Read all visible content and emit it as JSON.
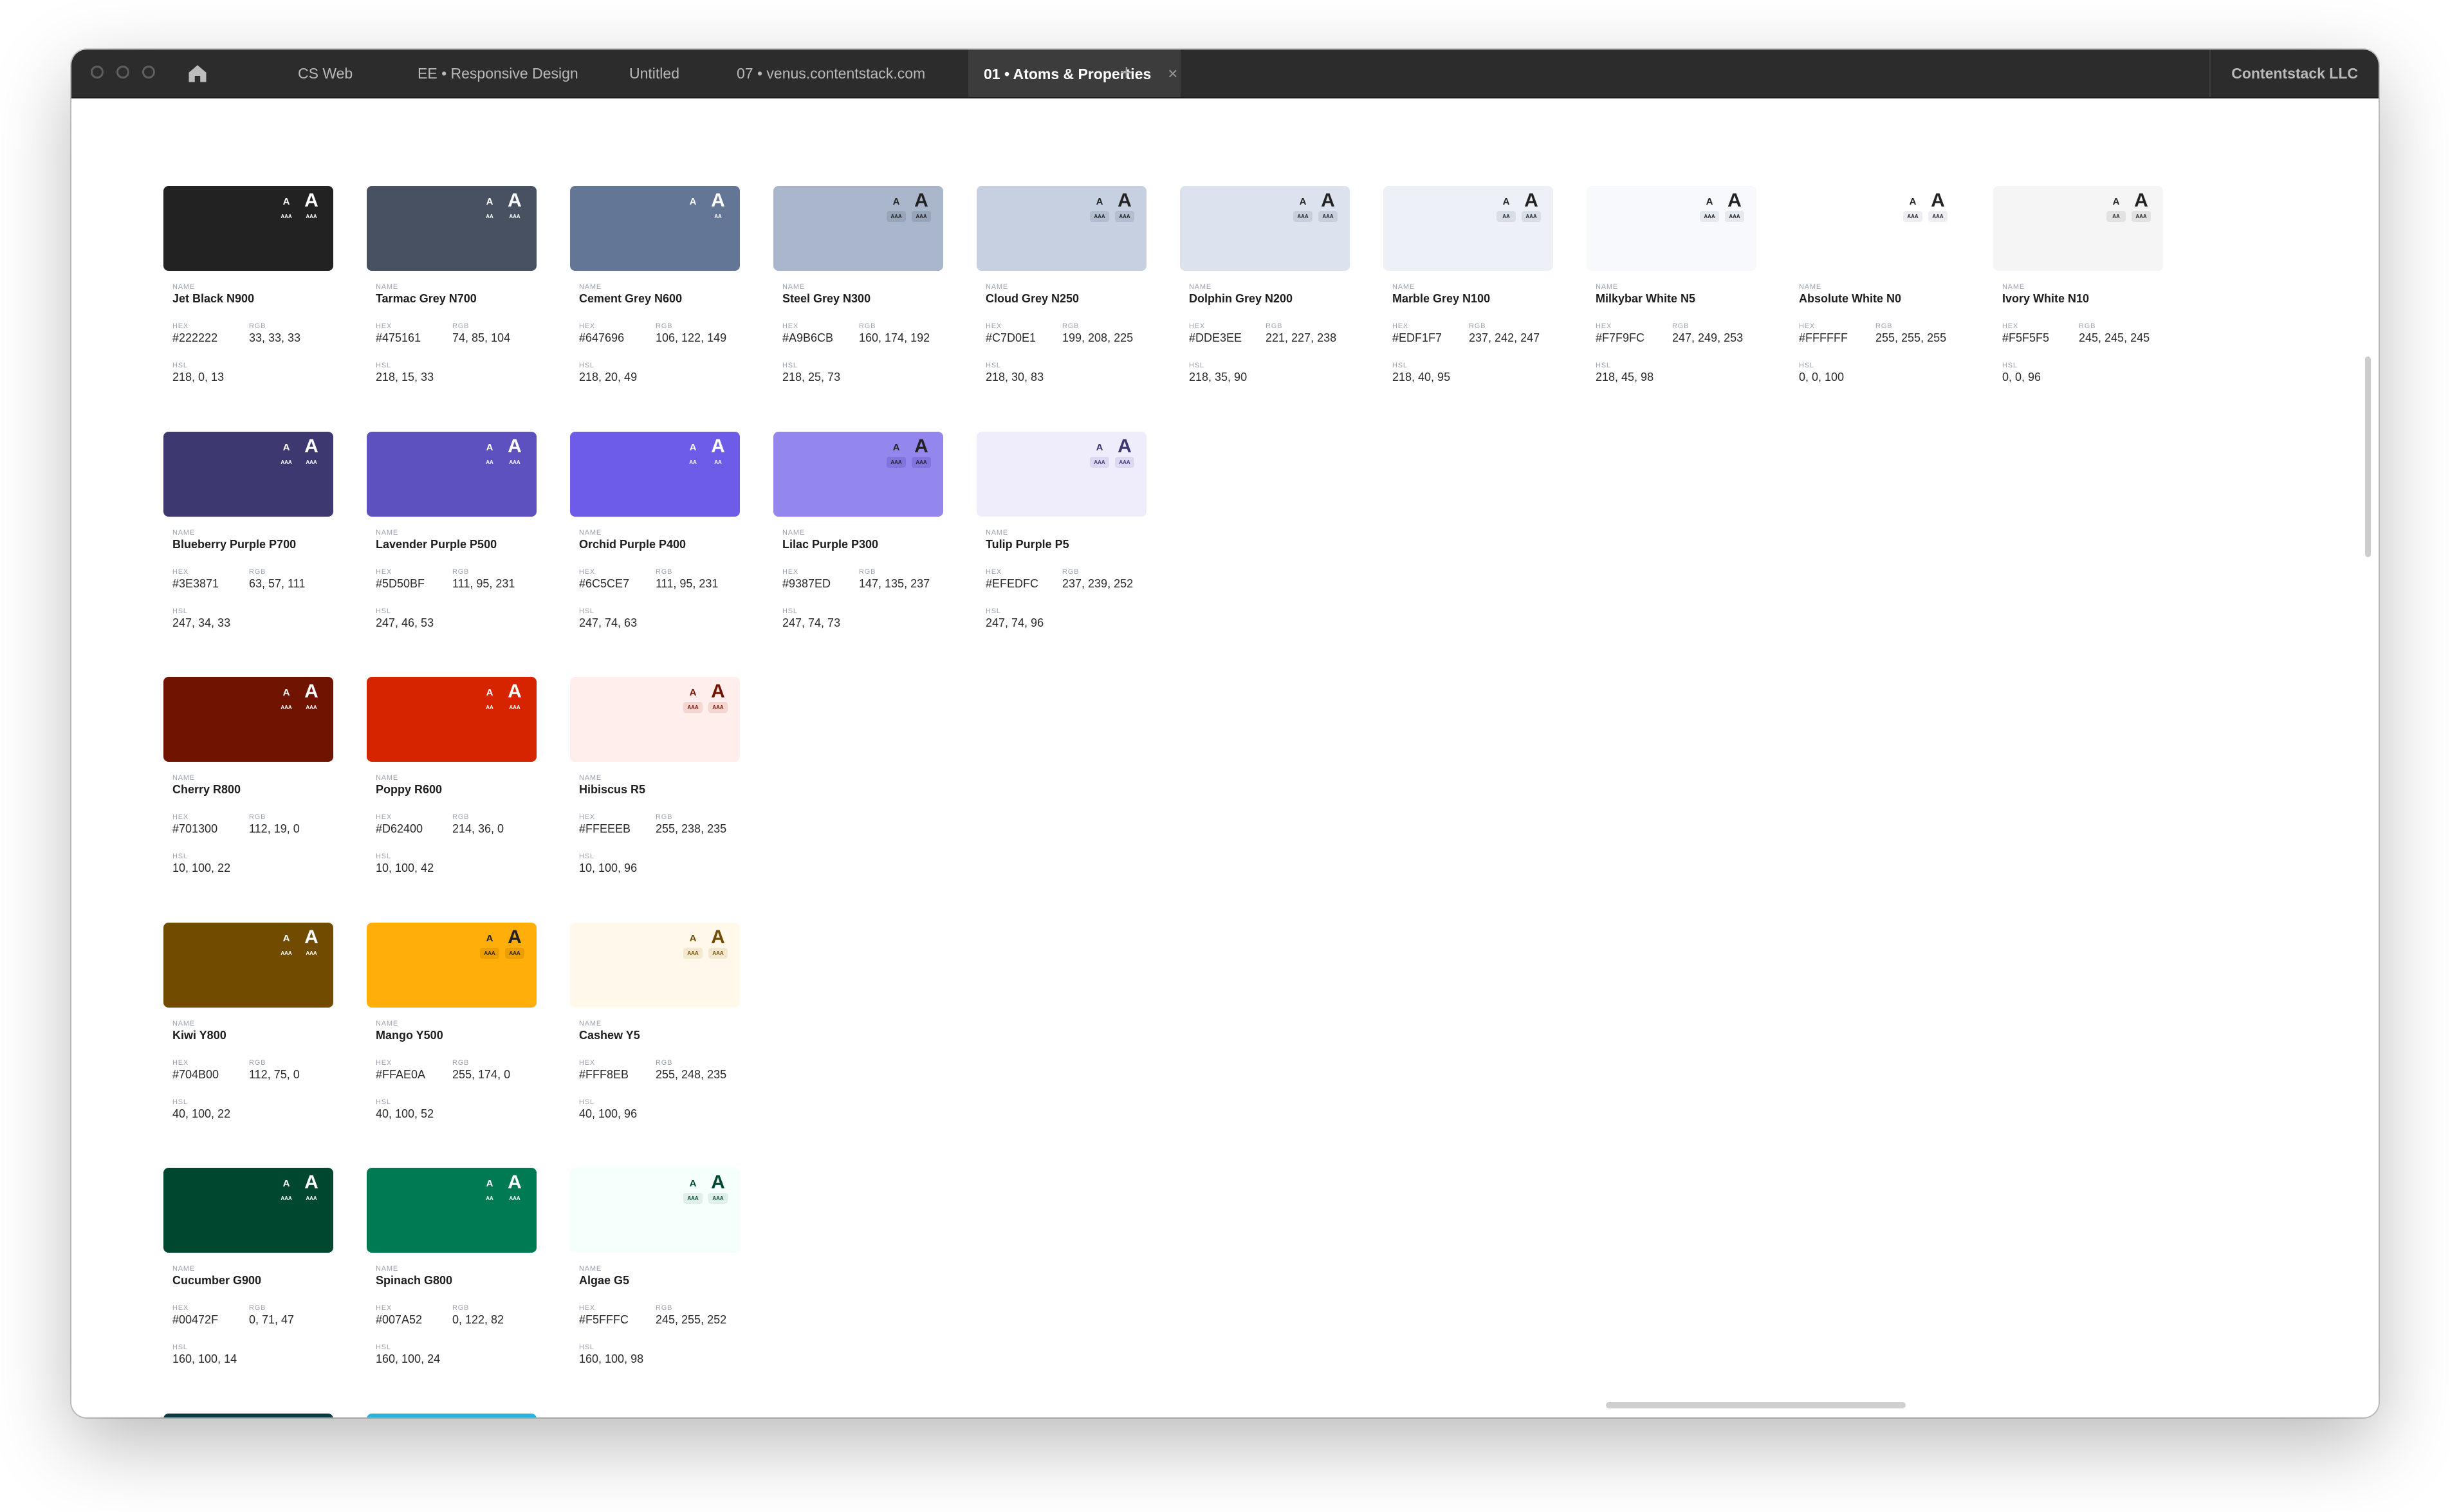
{
  "window": {
    "tabs": [
      {
        "label": "CS Web"
      },
      {
        "label": "EE • Responsive Design"
      },
      {
        "label": "Untitled"
      },
      {
        "label": "07 • venus.contentstack.com"
      },
      {
        "label": "01 • Atoms & Properties"
      }
    ],
    "active_tab_index": 4,
    "close_glyph": "×",
    "new_tab_glyph": "+",
    "org_name": "Contentstack LLC",
    "home_icon": "home-icon"
  },
  "labels": {
    "name": "NAME",
    "hex": "HEX",
    "rgb": "RGB",
    "hsl": "HSL"
  },
  "badges": {
    "glyph": "A",
    "aa": "AA",
    "aaa": "AAA"
  },
  "colors": [
    {
      "name": "Jet Black N900",
      "hex": "#222222",
      "rgb": "33, 33, 33",
      "hsl": "218, 0, 13",
      "fill": "#222222",
      "fg": "#ffffff",
      "small": "AAA",
      "big": "AAA",
      "pillbg": ""
    },
    {
      "name": "Tarmac Grey N700",
      "hex": "#475161",
      "rgb": "74, 85, 104",
      "hsl": "218, 15, 33",
      "fill": "#475161",
      "fg": "#ffffff",
      "small": "AA",
      "big": "AAA",
      "pillbg": ""
    },
    {
      "name": "Cement Grey N600",
      "hex": "#647696",
      "rgb": "106, 122, 149",
      "hsl": "218, 20, 49",
      "fill": "#647696",
      "fg": "#ffffff",
      "small": "",
      "big": "AA",
      "pillbg": ""
    },
    {
      "name": "Steel Grey N300",
      "hex": "#A9B6CB",
      "rgb": "160, 174, 192",
      "hsl": "218, 25, 73",
      "fill": "#A9B6CB",
      "fg": "#222222",
      "small": "AAA",
      "big": "AAA",
      "pillbg": "#97a4ba"
    },
    {
      "name": "Cloud Grey N250",
      "hex": "#C7D0E1",
      "rgb": "199, 208, 225",
      "hsl": "218, 30, 83",
      "fill": "#C7D0E1",
      "fg": "#222222",
      "small": "AAA",
      "big": "AAA",
      "pillbg": "#b3bdd0"
    },
    {
      "name": "Dolphin Grey N200",
      "hex": "#DDE3EE",
      "rgb": "221, 227, 238",
      "hsl": "218, 35, 90",
      "fill": "#DDE3EE",
      "fg": "#222222",
      "small": "AAA",
      "big": "AAA",
      "pillbg": "#c8d0de"
    },
    {
      "name": "Marble Grey N100",
      "hex": "#EDF1F7",
      "rgb": "237, 242, 247",
      "hsl": "218, 40, 95",
      "fill": "#EDF1F7",
      "fg": "#222222",
      "small": "AA",
      "big": "AAA",
      "pillbg": "#d8dee8"
    },
    {
      "name": "Milkybar White N5",
      "hex": "#F7F9FC",
      "rgb": "247, 249, 253",
      "hsl": "218, 45, 98",
      "fill": "#F7F9FC",
      "fg": "#222222",
      "small": "AAA",
      "big": "AAA",
      "pillbg": "#e4e8ef"
    },
    {
      "name": "Absolute White N0",
      "hex": "#FFFFFF",
      "rgb": "255, 255, 255",
      "hsl": "0, 0, 100",
      "fill": "#FFFFFF",
      "fg": "#222222",
      "small": "AAA",
      "big": "AAA",
      "pillbg": "#eceef2"
    },
    {
      "name": "Ivory White N10",
      "hex": "#F5F5F5",
      "rgb": "245, 245, 245",
      "hsl": "0, 0, 96",
      "fill": "#F5F5F5",
      "fg": "#222222",
      "small": "AA",
      "big": "AAA",
      "pillbg": "#e2e2e2"
    },
    {
      "name": "Blueberry Purple P700",
      "hex": "#3E3871",
      "rgb": "63, 57, 111",
      "hsl": "247, 34, 33",
      "fill": "#3E3871",
      "fg": "#ffffff",
      "small": "AAA",
      "big": "AAA",
      "pillbg": ""
    },
    {
      "name": "Lavender Purple P500",
      "hex": "#5D50BF",
      "rgb": "111, 95, 231",
      "hsl": "247, 46, 53",
      "fill": "#5D50BF",
      "fg": "#ffffff",
      "small": "AA",
      "big": "AAA",
      "pillbg": ""
    },
    {
      "name": "Orchid Purple P400",
      "hex": "#6C5CE7",
      "rgb": "111, 95, 231",
      "hsl": "247, 74, 63",
      "fill": "#6C5CE7",
      "fg": "#ffffff",
      "small": "AA",
      "big": "AA",
      "pillbg": ""
    },
    {
      "name": "Lilac Purple P300",
      "hex": "#9387ED",
      "rgb": "147, 135, 237",
      "hsl": "247, 74, 73",
      "fill": "#9387ED",
      "fg": "#222222",
      "small": "AAA",
      "big": "AAA",
      "pillbg": "#8175dd"
    },
    {
      "name": "Tulip Purple P5",
      "hex": "#EFEDFC",
      "rgb": "237, 239, 252",
      "hsl": "247, 74, 96",
      "fill": "#EFEDFC",
      "fg": "#3E3871",
      "small": "AAA",
      "big": "AAA",
      "pillbg": "#dcd8f2"
    },
    {
      "name": "Cherry R800",
      "hex": "#701300",
      "rgb": "112, 19, 0",
      "hsl": "10, 100, 22",
      "fill": "#701300",
      "fg": "#ffffff",
      "small": "AAA",
      "big": "AAA",
      "pillbg": ""
    },
    {
      "name": "Poppy R600",
      "hex": "#D62400",
      "rgb": "214, 36, 0",
      "hsl": "10, 100, 42",
      "fill": "#D62400",
      "fg": "#ffffff",
      "small": "AA",
      "big": "AAA",
      "pillbg": ""
    },
    {
      "name": "Hibiscus R5",
      "hex": "#FFEEEB",
      "rgb": "255, 238, 235",
      "hsl": "10, 100, 96",
      "fill": "#FFEEEB",
      "fg": "#701300",
      "small": "AAA",
      "big": "AAA",
      "pillbg": "#f6d6d0"
    },
    {
      "name": "Kiwi Y800",
      "hex": "#704B00",
      "rgb": "112, 75, 0",
      "hsl": "40, 100, 22",
      "fill": "#704B00",
      "fg": "#ffffff",
      "small": "AAA",
      "big": "AAA",
      "pillbg": ""
    },
    {
      "name": "Mango Y500",
      "hex": "#FFAE0A",
      "rgb": "255, 174, 0",
      "hsl": "40, 100, 52",
      "fill": "#FFAE0A",
      "fg": "#222222",
      "small": "AAA",
      "big": "AAA",
      "pillbg": "#eb9e00"
    },
    {
      "name": "Cashew Y5",
      "hex": "#FFF8EB",
      "rgb": "255, 248, 235",
      "hsl": "40, 100, 96",
      "fill": "#FFF8EB",
      "fg": "#704B00",
      "small": "AAA",
      "big": "AAA",
      "pillbg": "#f4e8cf"
    },
    {
      "name": "Cucumber G900",
      "hex": "#00472F",
      "rgb": "0, 71, 47",
      "hsl": "160, 100, 14",
      "fill": "#00472F",
      "fg": "#ffffff",
      "small": "AAA",
      "big": "AAA",
      "pillbg": ""
    },
    {
      "name": "Spinach G800",
      "hex": "#007A52",
      "rgb": "0, 122, 82",
      "hsl": "160, 100, 24",
      "fill": "#007A52",
      "fg": "#ffffff",
      "small": "AA",
      "big": "AAA",
      "pillbg": ""
    },
    {
      "name": "Algae G5",
      "hex": "#F5FFFC",
      "rgb": "245, 255, 252",
      "hsl": "160, 100, 98",
      "fill": "#F5FFFC",
      "fg": "#00472F",
      "small": "AAA",
      "big": "AAA",
      "pillbg": "#e0efe9"
    }
  ],
  "partial_swatches": [
    "#0c3a44",
    "#27b4dc"
  ]
}
